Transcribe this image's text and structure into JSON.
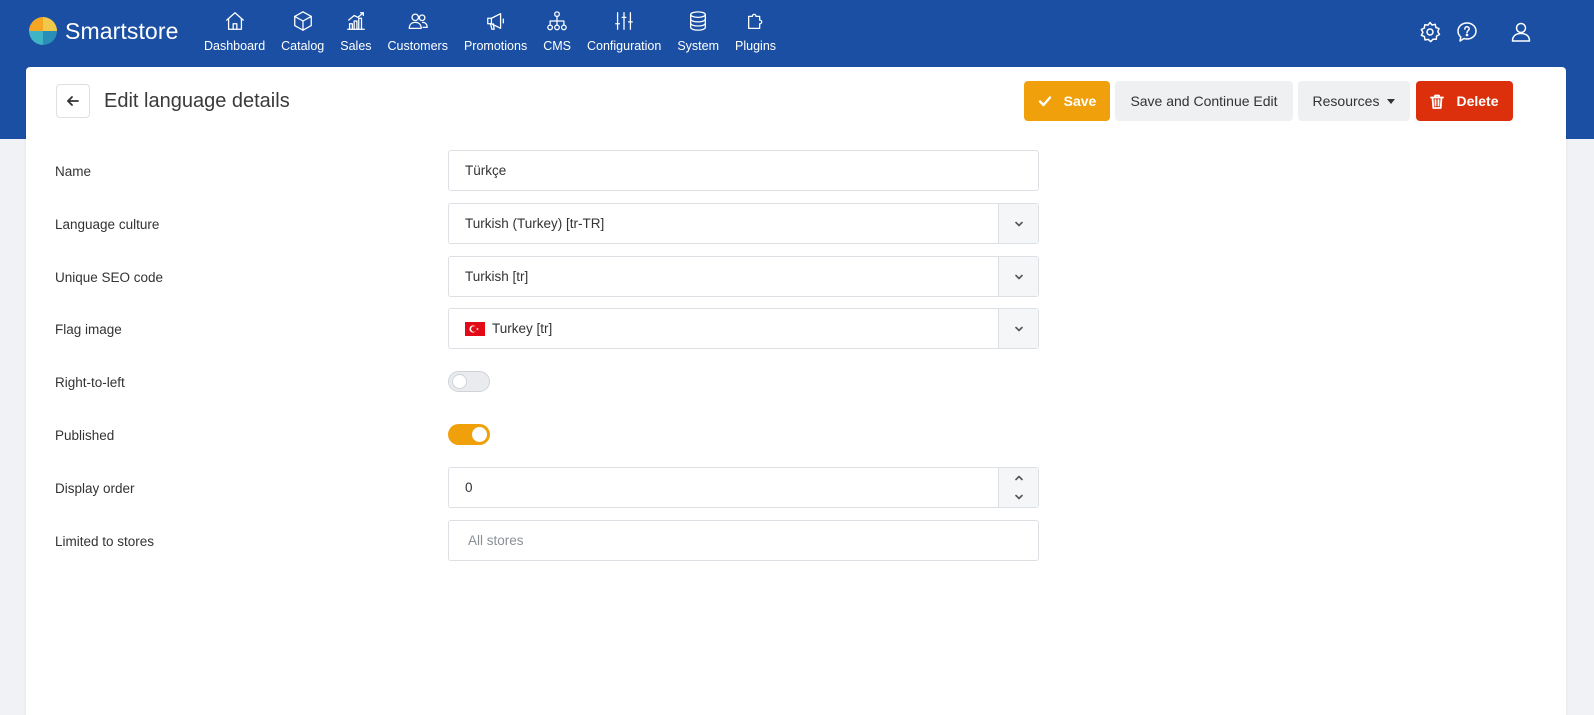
{
  "app": {
    "name": "Smartstore"
  },
  "nav": [
    {
      "label": "Dashboard",
      "icon": "home-icon"
    },
    {
      "label": "Catalog",
      "icon": "box-icon"
    },
    {
      "label": "Sales",
      "icon": "chart-icon"
    },
    {
      "label": "Customers",
      "icon": "users-icon"
    },
    {
      "label": "Promotions",
      "icon": "megaphone-icon"
    },
    {
      "label": "CMS",
      "icon": "sitemap-icon"
    },
    {
      "label": "Configuration",
      "icon": "sliders-icon"
    },
    {
      "label": "System",
      "icon": "database-icon"
    },
    {
      "label": "Plugins",
      "icon": "puzzle-icon"
    }
  ],
  "top_icons": [
    "settings-icon",
    "help-icon",
    "user-icon"
  ],
  "page": {
    "title": "Edit language details"
  },
  "toolbar": {
    "save_label": "Save",
    "save_continue_label": "Save and Continue Edit",
    "resources_label": "Resources",
    "delete_label": "Delete"
  },
  "form": {
    "name": {
      "label": "Name",
      "value": "Türkçe"
    },
    "language_culture": {
      "label": "Language culture",
      "value": "Turkish (Turkey) [tr-TR]"
    },
    "seo_code": {
      "label": "Unique SEO code",
      "value": "Turkish [tr]"
    },
    "flag_image": {
      "label": "Flag image",
      "value": "Turkey [tr]"
    },
    "rtl": {
      "label": "Right-to-left",
      "checked": false
    },
    "published": {
      "label": "Published",
      "checked": true
    },
    "display_order": {
      "label": "Display order",
      "value": "0"
    },
    "limited_stores": {
      "label": "Limited to stores",
      "placeholder": "All stores"
    }
  },
  "colors": {
    "header": "#1a4fa3",
    "accent": "#f0a00a",
    "danger": "#dc2f0c"
  }
}
